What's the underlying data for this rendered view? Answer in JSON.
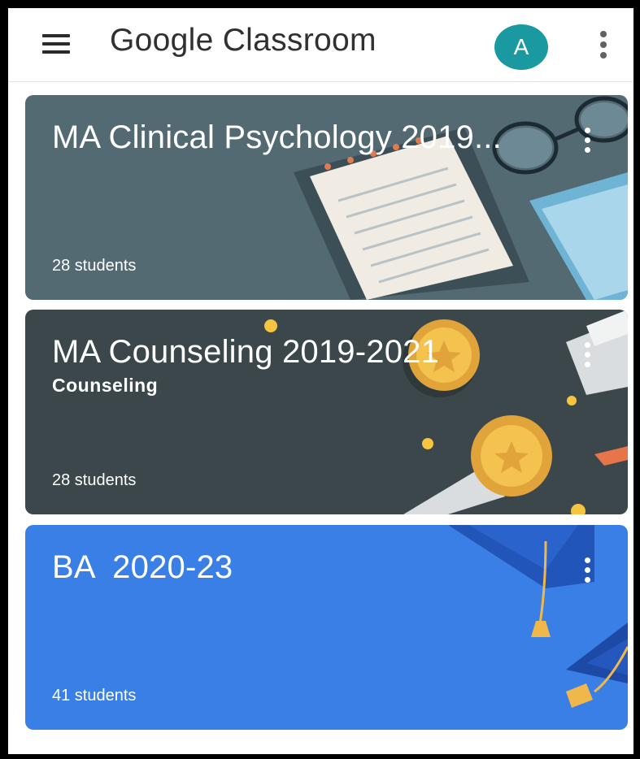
{
  "app": {
    "title": "Google Classroom",
    "avatar_letter": "A",
    "avatar_color": "#1a9aa0"
  },
  "icons": {
    "menu": "hamburger-menu-icon",
    "overflow": "more-vert-icon"
  },
  "classes": [
    {
      "title": "MA Clinical Psychology 2019...",
      "subtitle": "",
      "students": "28 students",
      "theme_color": "#536a73"
    },
    {
      "title": "MA Counseling 2019-2021",
      "subtitle": "Counseling",
      "students": "28 students",
      "theme_color": "#3b474a"
    },
    {
      "title": "BA  2020-23",
      "subtitle": "",
      "students": "41 students",
      "theme_color": "#3a7fe6"
    }
  ]
}
